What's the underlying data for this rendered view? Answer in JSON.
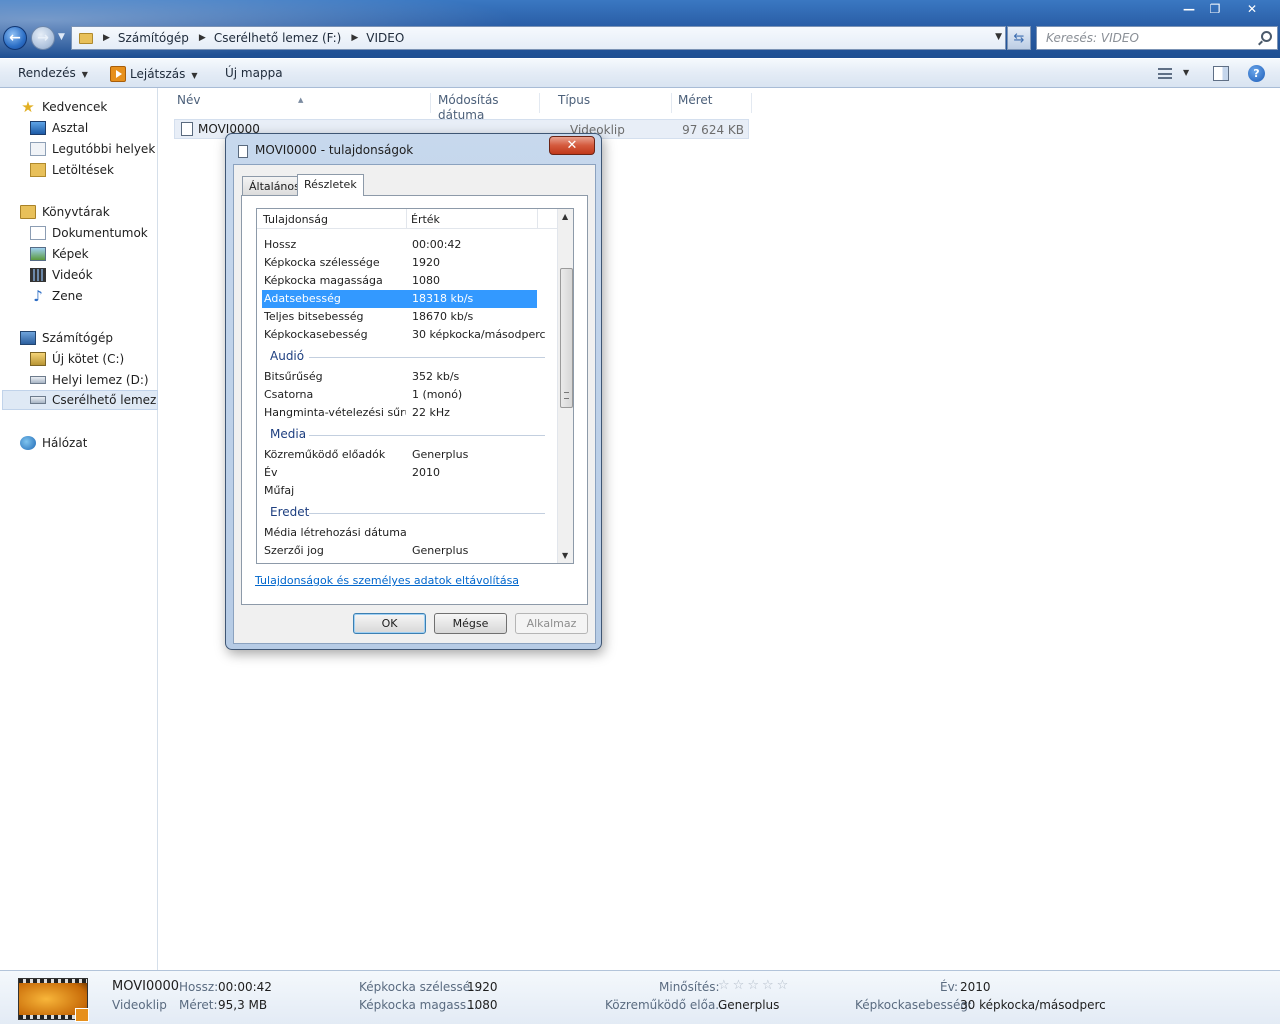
{
  "window": {
    "address": {
      "crumbs": [
        "Számítógép",
        "Cserélhető lemez (F:)",
        "VIDEO"
      ]
    },
    "search_placeholder": "Keresés: VIDEO",
    "controls": {
      "minimize": "—",
      "maximize": "❐",
      "close": "✕"
    }
  },
  "commandbar": {
    "organize": "Rendezés",
    "play": "Lejátszás",
    "new_folder": "Új mappa",
    "help": "?"
  },
  "navpane": {
    "favorites": {
      "label": "Kedvencek",
      "items": [
        "Asztal",
        "Legutóbbi helyek",
        "Letöltések"
      ]
    },
    "libraries": {
      "label": "Könyvtárak",
      "items": [
        "Dokumentumok",
        "Képek",
        "Videók",
        "Zene"
      ]
    },
    "computer": {
      "label": "Számítógép",
      "items": [
        "Új kötet (C:)",
        "Helyi lemez (D:)",
        "Cserélhető lemez (F:"
      ]
    },
    "network": {
      "label": "Hálózat"
    }
  },
  "filelist": {
    "columns": [
      "Név",
      "Módosítás dátuma",
      "Típus",
      "Méret"
    ],
    "files": [
      {
        "name": "MOVI0000",
        "type": "Videoklip",
        "size": "97 624 KB"
      }
    ]
  },
  "dialog": {
    "title": "MOVI0000 - tulajdonságok",
    "close": "✕",
    "tabs": [
      "Általános",
      "Részletek"
    ],
    "columns": [
      "Tulajdonság",
      "Érték"
    ],
    "video_rows": [
      {
        "name": "Hossz",
        "value": "00:00:42"
      },
      {
        "name": "Képkocka szélessége",
        "value": "1920"
      },
      {
        "name": "Képkocka magassága",
        "value": "1080"
      },
      {
        "name": "Adatsebesség",
        "value": "18318 kb/s"
      },
      {
        "name": "Teljes bitsebesség",
        "value": "18670 kb/s"
      },
      {
        "name": "Képkockasebesség",
        "value": "30 képkocka/másodperc"
      }
    ],
    "groups": {
      "audio": {
        "title": "Audió",
        "rows": [
          {
            "name": "Bitsűrűség",
            "value": "352 kb/s"
          },
          {
            "name": "Csatorna",
            "value": "1 (monó)"
          },
          {
            "name": "Hangminta-vételezési sűrű…",
            "value": "22 kHz"
          }
        ]
      },
      "media": {
        "title": "Media",
        "rows": [
          {
            "name": "Közreműködő előadók",
            "value": "Generplus"
          },
          {
            "name": "Év",
            "value": "2010"
          },
          {
            "name": "Műfaj",
            "value": ""
          }
        ]
      },
      "origin": {
        "title": "Eredet",
        "rows": [
          {
            "name": "Média létrehozási dátuma",
            "value": ""
          },
          {
            "name": "Szerzői jog",
            "value": "Generplus"
          }
        ]
      }
    },
    "remove_link": "Tulajdonságok és személyes adatok eltávolítása",
    "buttons": {
      "ok": "OK",
      "cancel": "Mégse",
      "apply": "Alkalmaz"
    }
  },
  "details": {
    "name": "MOVI0000",
    "type": "Videoklip",
    "length_label": "Hossz:",
    "length": "00:00:42",
    "size_label": "Méret:",
    "size": "95,3 MB",
    "width_label": "Képkocka szélessé...",
    "width": "1920",
    "height_label": "Képkocka magass...",
    "height": "1080",
    "rating_label": "Minősítés:",
    "rating_stars": 0,
    "rating_max": 5,
    "artist_label": "Közreműködő előa...",
    "artist": "Generplus",
    "year_label": "Év:",
    "year": "2010",
    "framerate_label": "Képkockasebesség:",
    "framerate": "30 képkocka/másodperc"
  }
}
